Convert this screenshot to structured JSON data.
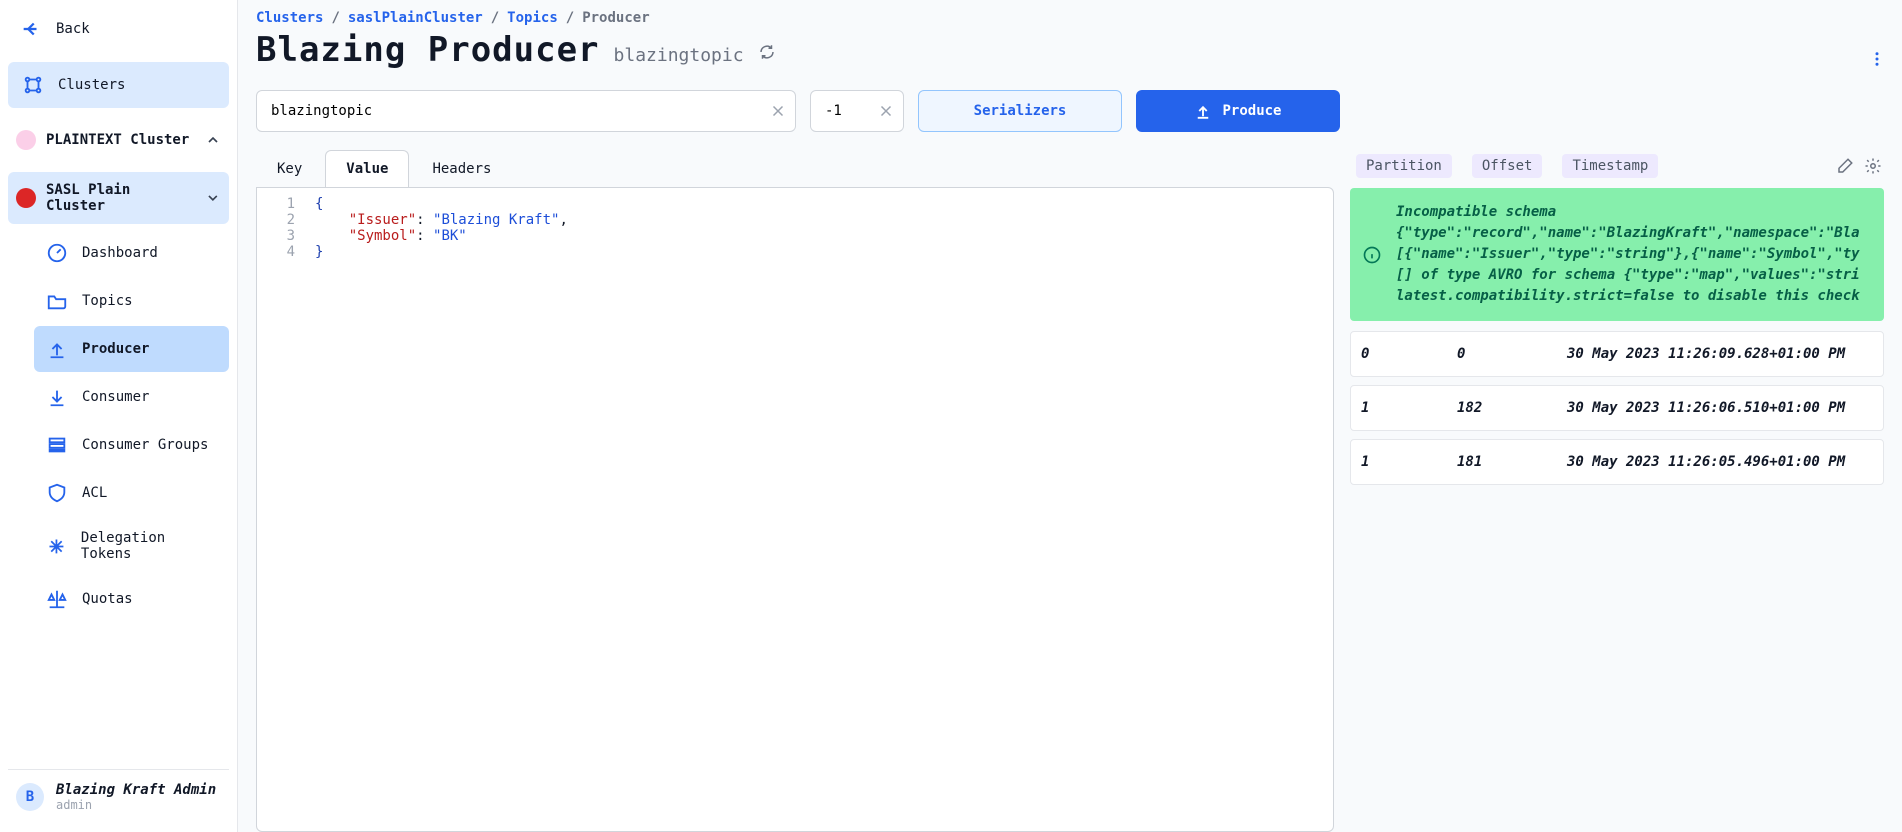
{
  "sidebar": {
    "back_label": "Back",
    "clusters_label": "Clusters",
    "cluster_a": "PLAINTEXT Cluster",
    "cluster_b": "SASL Plain Cluster",
    "nav": {
      "dashboard": "Dashboard",
      "topics": "Topics",
      "producer": "Producer",
      "consumer": "Consumer",
      "consumer_groups": "Consumer Groups",
      "acl": "ACL",
      "delegation_tokens": "Delegation Tokens",
      "quotas": "Quotas"
    },
    "user": {
      "avatar": "B",
      "name": "Blazing Kraft Admin",
      "sub": "admin"
    }
  },
  "breadcrumb": {
    "b0": "Clusters",
    "b1": "saslPlainCluster",
    "b2": "Topics",
    "b3": "Producer"
  },
  "header": {
    "title": "Blazing Producer",
    "topic": "blazingtopic"
  },
  "toolbar": {
    "topic_value": "blazingtopic",
    "partition_value": "-1",
    "serializers_label": "Serializers",
    "produce_label": "Produce"
  },
  "tabs": {
    "key": "Key",
    "value": "Value",
    "headers": "Headers"
  },
  "editor": {
    "line1_open": "{",
    "line2_key": "\"Issuer\"",
    "line2_val": "\"Blazing Kraft\"",
    "line3_key": "\"Symbol\"",
    "line3_val": "\"BK\"",
    "line4_close": "}"
  },
  "results": {
    "h_partition": "Partition",
    "h_offset": "Offset",
    "h_timestamp": "Timestamp",
    "error_l1": "Incompatible schema",
    "error_l2": "{\"type\":\"record\",\"name\":\"BlazingKraft\",\"namespace\":\"Bla",
    "error_l3": "[{\"name\":\"Issuer\",\"type\":\"string\"},{\"name\":\"Symbol\",\"ty",
    "error_l4": "[] of type AVRO for schema {\"type\":\"map\",\"values\":\"stri",
    "error_l5": "latest.compatibility.strict=false to disable this check",
    "rows": [
      {
        "partition": "0",
        "offset": "0",
        "ts": "30 May 2023 11:26:09.628+01:00 PM"
      },
      {
        "partition": "1",
        "offset": "182",
        "ts": "30 May 2023 11:26:06.510+01:00 PM"
      },
      {
        "partition": "1",
        "offset": "181",
        "ts": "30 May 2023 11:26:05.496+01:00 PM"
      }
    ]
  },
  "chart_data": {
    "type": "table",
    "columns": [
      "Partition",
      "Offset",
      "Timestamp"
    ],
    "rows": [
      [
        "0",
        "0",
        "30 May 2023 11:26:09.628+01:00 PM"
      ],
      [
        "1",
        "182",
        "30 May 2023 11:26:06.510+01:00 PM"
      ],
      [
        "1",
        "181",
        "30 May 2023 11:26:05.496+01:00 PM"
      ]
    ]
  }
}
